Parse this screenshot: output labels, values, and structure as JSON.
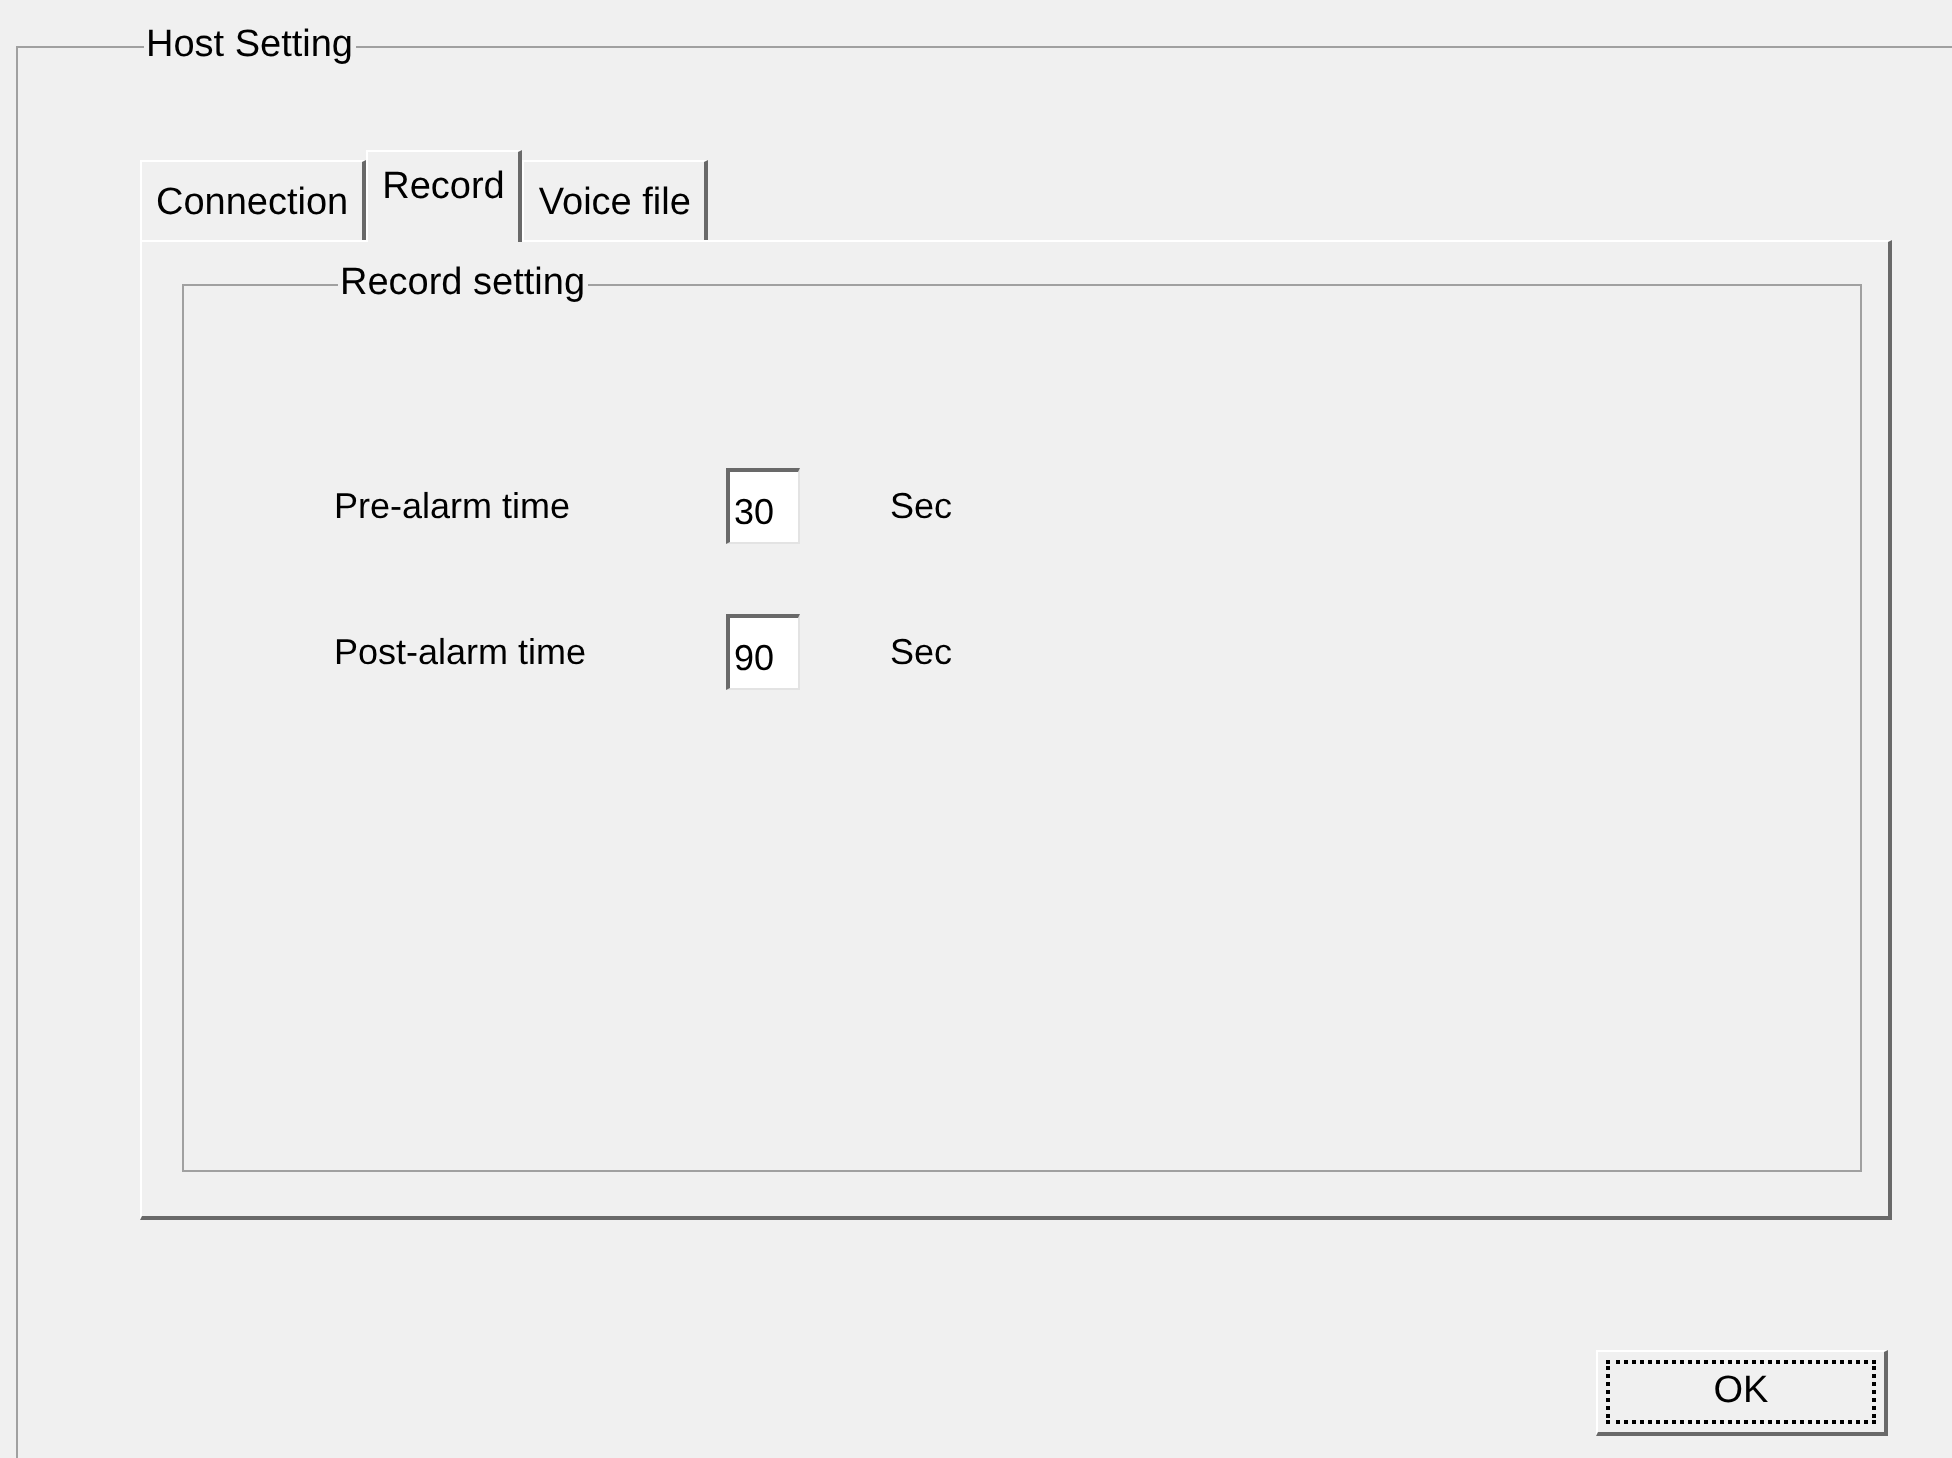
{
  "group": {
    "title": "Host Setting"
  },
  "tabs": [
    {
      "label": "Connection",
      "selected": false
    },
    {
      "label": "Record",
      "selected": true
    },
    {
      "label": "Voice file",
      "selected": false
    }
  ],
  "record_group": {
    "title": "Record setting"
  },
  "fields": [
    {
      "label": "Pre-alarm time",
      "value": "30",
      "unit": "Sec"
    },
    {
      "label": "Post-alarm time",
      "value": "90",
      "unit": "Sec"
    }
  ],
  "ok_button": {
    "label": "OK",
    "focused": true
  }
}
